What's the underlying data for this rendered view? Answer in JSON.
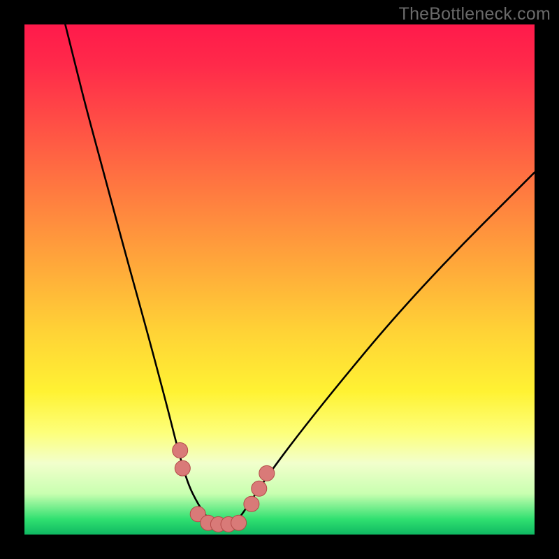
{
  "watermark": "TheBottleneck.com",
  "colors": {
    "frame": "#000000",
    "gradient_top": "#ff1a4b",
    "gradient_mid": "#fff233",
    "gradient_bottom": "#0fb862",
    "curve": "#000000",
    "marker": "#d97a78",
    "marker_stroke": "#b34a48"
  },
  "chart_data": {
    "type": "line",
    "title": "",
    "xlabel": "",
    "ylabel": "",
    "xlim": [
      0,
      100
    ],
    "ylim": [
      0,
      100
    ],
    "series": [
      {
        "name": "curve",
        "x": [
          8,
          10,
          12,
          15,
          19,
          24,
          28,
          30,
          32,
          34,
          36,
          38,
          40,
          42,
          44,
          48,
          54,
          62,
          72,
          84,
          96,
          100
        ],
        "values": [
          100,
          92,
          84,
          73,
          58,
          40,
          25,
          17,
          10,
          6,
          3,
          2,
          2,
          3,
          6,
          12,
          20,
          30,
          42,
          55,
          67,
          71
        ]
      }
    ],
    "markers": [
      {
        "x": 30.5,
        "y": 16.5
      },
      {
        "x": 31.0,
        "y": 13.0
      },
      {
        "x": 34.0,
        "y": 4.0
      },
      {
        "x": 36.0,
        "y": 2.3
      },
      {
        "x": 38.0,
        "y": 2.0
      },
      {
        "x": 40.0,
        "y": 2.0
      },
      {
        "x": 42.0,
        "y": 2.3
      },
      {
        "x": 44.5,
        "y": 6.0
      },
      {
        "x": 46.0,
        "y": 9.0
      },
      {
        "x": 47.5,
        "y": 12.0
      }
    ]
  }
}
